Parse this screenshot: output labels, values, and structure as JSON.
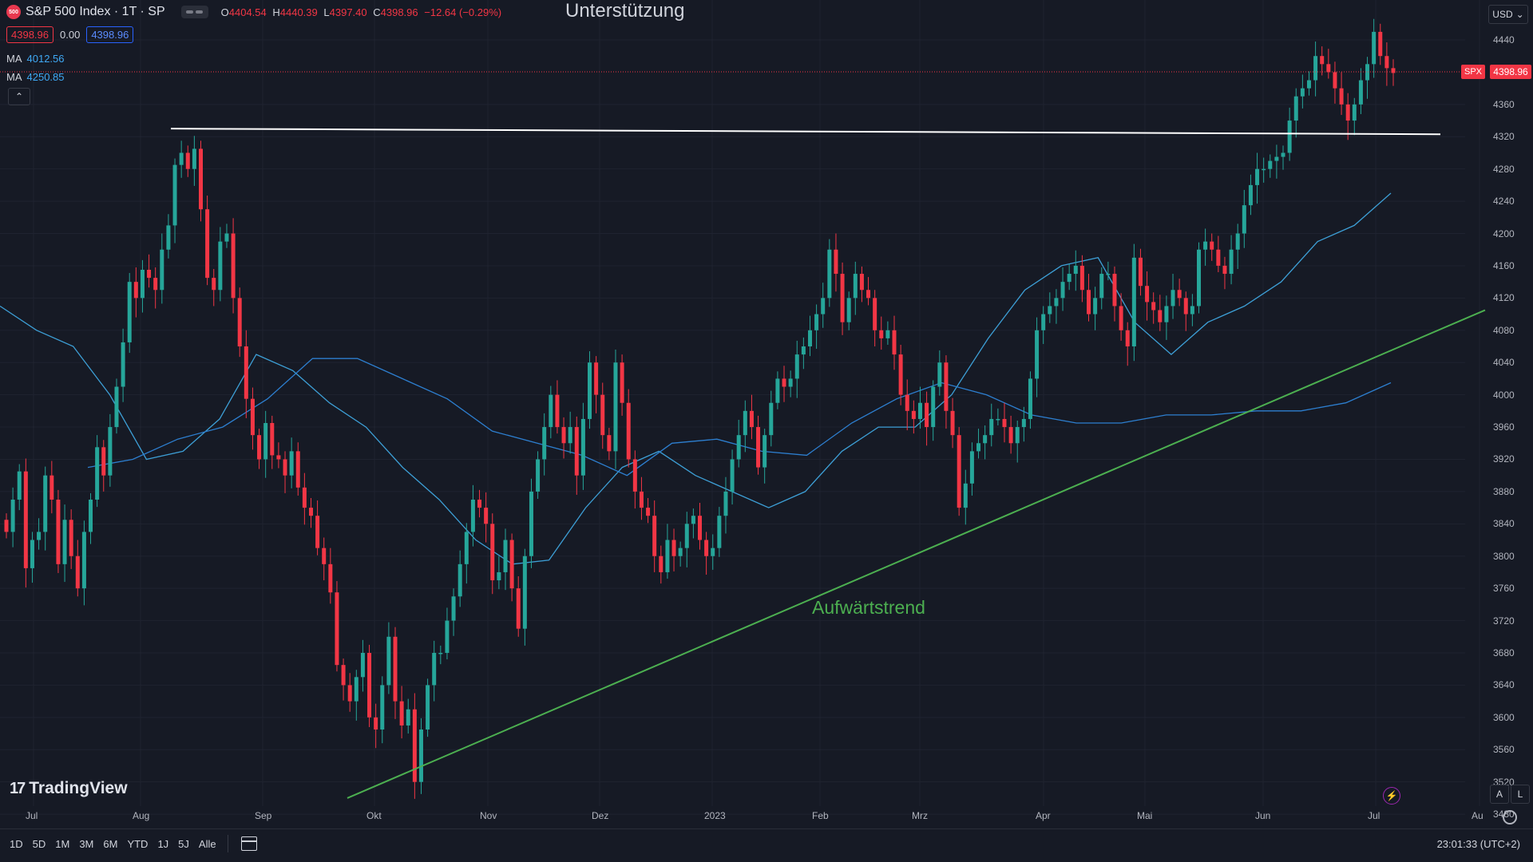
{
  "header": {
    "symbol_icon": "500",
    "title": "S&P 500 Index · 1T · SP",
    "ohlc": {
      "o_label": "O",
      "o": "4404.54",
      "h_label": "H",
      "h": "4440.39",
      "l_label": "L",
      "l": "4397.40",
      "c_label": "C",
      "c": "4398.96",
      "change": "−12.64 (−0.29%)"
    },
    "bid": "4398.96",
    "spread": "0.00",
    "ask": "4398.96",
    "ma1_label": "MA",
    "ma1_value": "4012.56",
    "ma2_label": "MA",
    "ma2_value": "4250.85"
  },
  "currency": "USD",
  "annotations": {
    "resistance": "Unterstützung",
    "trend": "Aufwärtstrend"
  },
  "price_label": {
    "symbol": "SPX",
    "value": "4398.96"
  },
  "logo": "TradingView",
  "axis_toggles": [
    "A",
    "L"
  ],
  "timeframes": [
    "1D",
    "5D",
    "1M",
    "3M",
    "6M",
    "YTD",
    "1J",
    "5J",
    "Alle"
  ],
  "clock": "23:01:33 (UTC+2)",
  "colors": {
    "up": "#26a69a",
    "down": "#f23645",
    "ma_fast": "#3d9fd6",
    "ma_slow": "#2d7fd0",
    "trend": "#4caf50",
    "support": "#ffffff",
    "bg": "#161a25"
  },
  "chart_data": {
    "type": "candlestick",
    "ylim": [
      3450,
      4480
    ],
    "y_ticks": [
      3480,
      3520,
      3560,
      3600,
      3640,
      3680,
      3720,
      3760,
      3800,
      3840,
      3880,
      3920,
      3960,
      4000,
      4040,
      4080,
      4120,
      4160,
      4200,
      4240,
      4280,
      4320,
      4360,
      4440
    ],
    "x_labels": [
      "Jul",
      "Aug",
      "Sep",
      "Okt",
      "Nov",
      "Dez",
      "2023",
      "Feb",
      "Mrz",
      "Apr",
      "Mai",
      "Jun",
      "Jul",
      "Au"
    ],
    "close_series": [
      3830,
      3870,
      3905,
      3785,
      3820,
      3830,
      3900,
      3870,
      3790,
      3845,
      3800,
      3760,
      3830,
      3870,
      3935,
      3900,
      3960,
      4010,
      4065,
      4140,
      4120,
      4155,
      4145,
      4130,
      4180,
      4210,
      4285,
      4300,
      4280,
      4305,
      4230,
      4145,
      4130,
      4190,
      4200,
      4120,
      4060,
      3995,
      3950,
      3920,
      3965,
      3925,
      3920,
      3900,
      3930,
      3885,
      3860,
      3850,
      3810,
      3790,
      3755,
      3665,
      3640,
      3620,
      3650,
      3680,
      3600,
      3585,
      3640,
      3700,
      3620,
      3590,
      3610,
      3520,
      3585,
      3640,
      3680,
      3680,
      3720,
      3750,
      3790,
      3830,
      3870,
      3860,
      3840,
      3770,
      3780,
      3820,
      3760,
      3710,
      3800,
      3880,
      3920,
      3960,
      4000,
      3960,
      3940,
      3960,
      3900,
      3970,
      4040,
      4000,
      3950,
      3930,
      4040,
      3990,
      3920,
      3880,
      3860,
      3850,
      3800,
      3780,
      3820,
      3800,
      3810,
      3840,
      3850,
      3820,
      3800,
      3810,
      3850,
      3880,
      3920,
      3950,
      3980,
      3960,
      3910,
      3950,
      3990,
      4020,
      4010,
      4020,
      4050,
      4060,
      4080,
      4100,
      4120,
      4180,
      4150,
      4090,
      4120,
      4150,
      4130,
      4120,
      4080,
      4070,
      4080,
      4050,
      4000,
      3980,
      3970,
      3990,
      3960,
      4010,
      4040,
      3980,
      3950,
      3860,
      3890,
      3930,
      3940,
      3950,
      3970,
      3970,
      3960,
      3940,
      3960,
      3970,
      4020,
      4080,
      4100,
      4110,
      4120,
      4140,
      4150,
      4160,
      4130,
      4100,
      4120,
      4150,
      4150,
      4110,
      4080,
      4060,
      4170,
      4135,
      4115,
      4105,
      4090,
      4110,
      4130,
      4120,
      4100,
      4110,
      4180,
      4190,
      4180,
      4160,
      4150,
      4180,
      4200,
      4235,
      4260,
      4280,
      4280,
      4290,
      4295,
      4300,
      4340,
      4370,
      4380,
      4390,
      4420,
      4410,
      4400,
      4380,
      4360,
      4340,
      4360,
      4390,
      4410,
      4450,
      4420,
      4405,
      4399
    ],
    "ma_fast_values": [
      4110,
      4080,
      4060,
      4000,
      3920,
      3930,
      3970,
      4050,
      4030,
      3990,
      3960,
      3910,
      3870,
      3820,
      3790,
      3795,
      3860,
      3910,
      3930,
      3900,
      3880,
      3860,
      3880,
      3930,
      3960,
      3960,
      4000,
      4070,
      4130,
      4160,
      4170,
      4090,
      4050,
      4090,
      4110,
      4140,
      4190,
      4210,
      4250
    ],
    "ma_slow_values": [
      3910,
      3920,
      3945,
      3960,
      3995,
      4045,
      4045,
      4020,
      3995,
      3955,
      3940,
      3925,
      3900,
      3940,
      3945,
      3930,
      3925,
      3965,
      3995,
      4015,
      4000,
      3975,
      3965,
      3965,
      3975,
      3975,
      3980,
      3980,
      3990,
      4015
    ],
    "support_line": {
      "from": 4330,
      "to": 4323
    },
    "trend_line": {
      "from": 3500,
      "to": 4105
    }
  }
}
